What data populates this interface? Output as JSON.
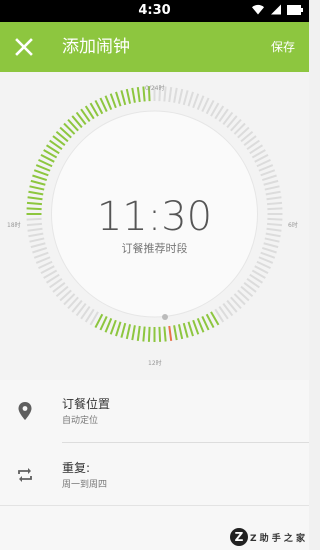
{
  "status_bar": {
    "time": "4:30",
    "icons": [
      "wifi-icon",
      "signal-icon",
      "battery-icon"
    ]
  },
  "app_bar": {
    "title": "添加闹钟",
    "save_label": "保存",
    "close_icon": "close-icon",
    "background": "#8dc63f"
  },
  "dial": {
    "time": "11:30",
    "subtitle": "订餐推荐时段",
    "hour_labels": {
      "top": "0/24时",
      "right": "6时",
      "bottom": "12时",
      "left": "18时"
    },
    "highlight_ranges_hours": [
      [
        18.0,
        24.0
      ],
      [
        10.0,
        14.0
      ]
    ],
    "selected_hour": 11.5,
    "colors": {
      "ticks_active": "#8dc63f",
      "ticks_inactive": "#dcdcdc",
      "selected_tick": "#e8734a"
    }
  },
  "settings": [
    {
      "title": "订餐位置",
      "subtitle": "自动定位",
      "icon": "location-pin-icon"
    },
    {
      "title": "重复:",
      "subtitle": "周一到周四",
      "icon": "repeat-icon"
    }
  ],
  "watermark": {
    "badge": "Z",
    "text": "Z 助 手 之 家"
  }
}
